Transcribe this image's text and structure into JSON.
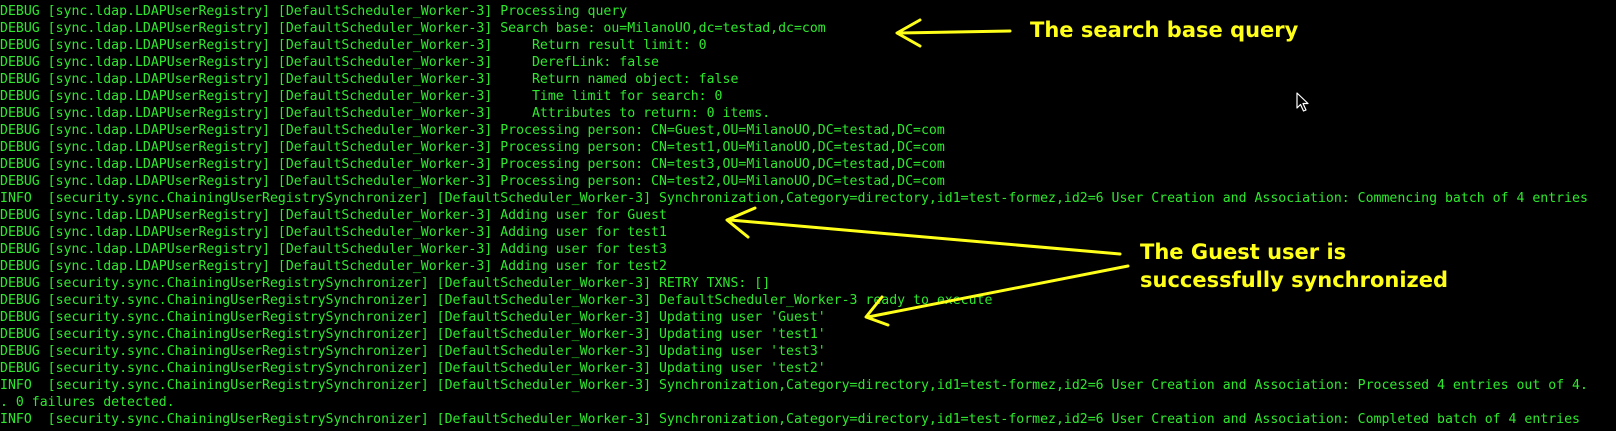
{
  "colors": {
    "background": "#000000",
    "log_text": "#2ee82e",
    "annotation": "#ffff1a"
  },
  "log_lines": [
    "DEBUG [sync.ldap.LDAPUserRegistry] [DefaultScheduler_Worker-3] Processing query",
    "DEBUG [sync.ldap.LDAPUserRegistry] [DefaultScheduler_Worker-3] Search base: ou=MilanoUO,dc=testad,dc=com",
    "DEBUG [sync.ldap.LDAPUserRegistry] [DefaultScheduler_Worker-3]     Return result limit: 0",
    "DEBUG [sync.ldap.LDAPUserRegistry] [DefaultScheduler_Worker-3]     DerefLink: false",
    "DEBUG [sync.ldap.LDAPUserRegistry] [DefaultScheduler_Worker-3]     Return named object: false",
    "DEBUG [sync.ldap.LDAPUserRegistry] [DefaultScheduler_Worker-3]     Time limit for search: 0",
    "DEBUG [sync.ldap.LDAPUserRegistry] [DefaultScheduler_Worker-3]     Attributes to return: 0 items.",
    "DEBUG [sync.ldap.LDAPUserRegistry] [DefaultScheduler_Worker-3] Processing person: CN=Guest,OU=MilanoUO,DC=testad,DC=com",
    "DEBUG [sync.ldap.LDAPUserRegistry] [DefaultScheduler_Worker-3] Processing person: CN=test1,OU=MilanoUO,DC=testad,DC=com",
    "DEBUG [sync.ldap.LDAPUserRegistry] [DefaultScheduler_Worker-3] Processing person: CN=test3,OU=MilanoUO,DC=testad,DC=com",
    "DEBUG [sync.ldap.LDAPUserRegistry] [DefaultScheduler_Worker-3] Processing person: CN=test2,OU=MilanoUO,DC=testad,DC=com",
    "INFO  [security.sync.ChainingUserRegistrySynchronizer] [DefaultScheduler_Worker-3] Synchronization,Category=directory,id1=test-formez,id2=6 User Creation and Association: Commencing batch of 4 entries",
    "DEBUG [sync.ldap.LDAPUserRegistry] [DefaultScheduler_Worker-3] Adding user for Guest",
    "DEBUG [sync.ldap.LDAPUserRegistry] [DefaultScheduler_Worker-3] Adding user for test1",
    "DEBUG [sync.ldap.LDAPUserRegistry] [DefaultScheduler_Worker-3] Adding user for test3",
    "DEBUG [sync.ldap.LDAPUserRegistry] [DefaultScheduler_Worker-3] Adding user for test2",
    "DEBUG [security.sync.ChainingUserRegistrySynchronizer] [DefaultScheduler_Worker-3] RETRY TXNS: []",
    "DEBUG [security.sync.ChainingUserRegistrySynchronizer] [DefaultScheduler_Worker-3] DefaultScheduler_Worker-3 ready to execute",
    "DEBUG [security.sync.ChainingUserRegistrySynchronizer] [DefaultScheduler_Worker-3] Updating user 'Guest'",
    "DEBUG [security.sync.ChainingUserRegistrySynchronizer] [DefaultScheduler_Worker-3] Updating user 'test1'",
    "DEBUG [security.sync.ChainingUserRegistrySynchronizer] [DefaultScheduler_Worker-3] Updating user 'test3'",
    "DEBUG [security.sync.ChainingUserRegistrySynchronizer] [DefaultScheduler_Worker-3] Updating user 'test2'",
    "INFO  [security.sync.ChainingUserRegistrySynchronizer] [DefaultScheduler_Worker-3] Synchronization,Category=directory,id1=test-formez,id2=6 User Creation and Association: Processed 4 entries out of 4.",
    ". 0 failures detected.",
    "INFO  [security.sync.ChainingUserRegistrySynchronizer] [DefaultScheduler_Worker-3] Synchronization,Category=directory,id1=test-formez,id2=6 User Creation and Association: Completed batch of 4 entries"
  ],
  "annotations": {
    "search_base": "The search base query",
    "guest_line1": "The Guest user is",
    "guest_line2": "successfully synchronized"
  },
  "icons": {
    "cursor": "mouse-pointer-icon"
  }
}
